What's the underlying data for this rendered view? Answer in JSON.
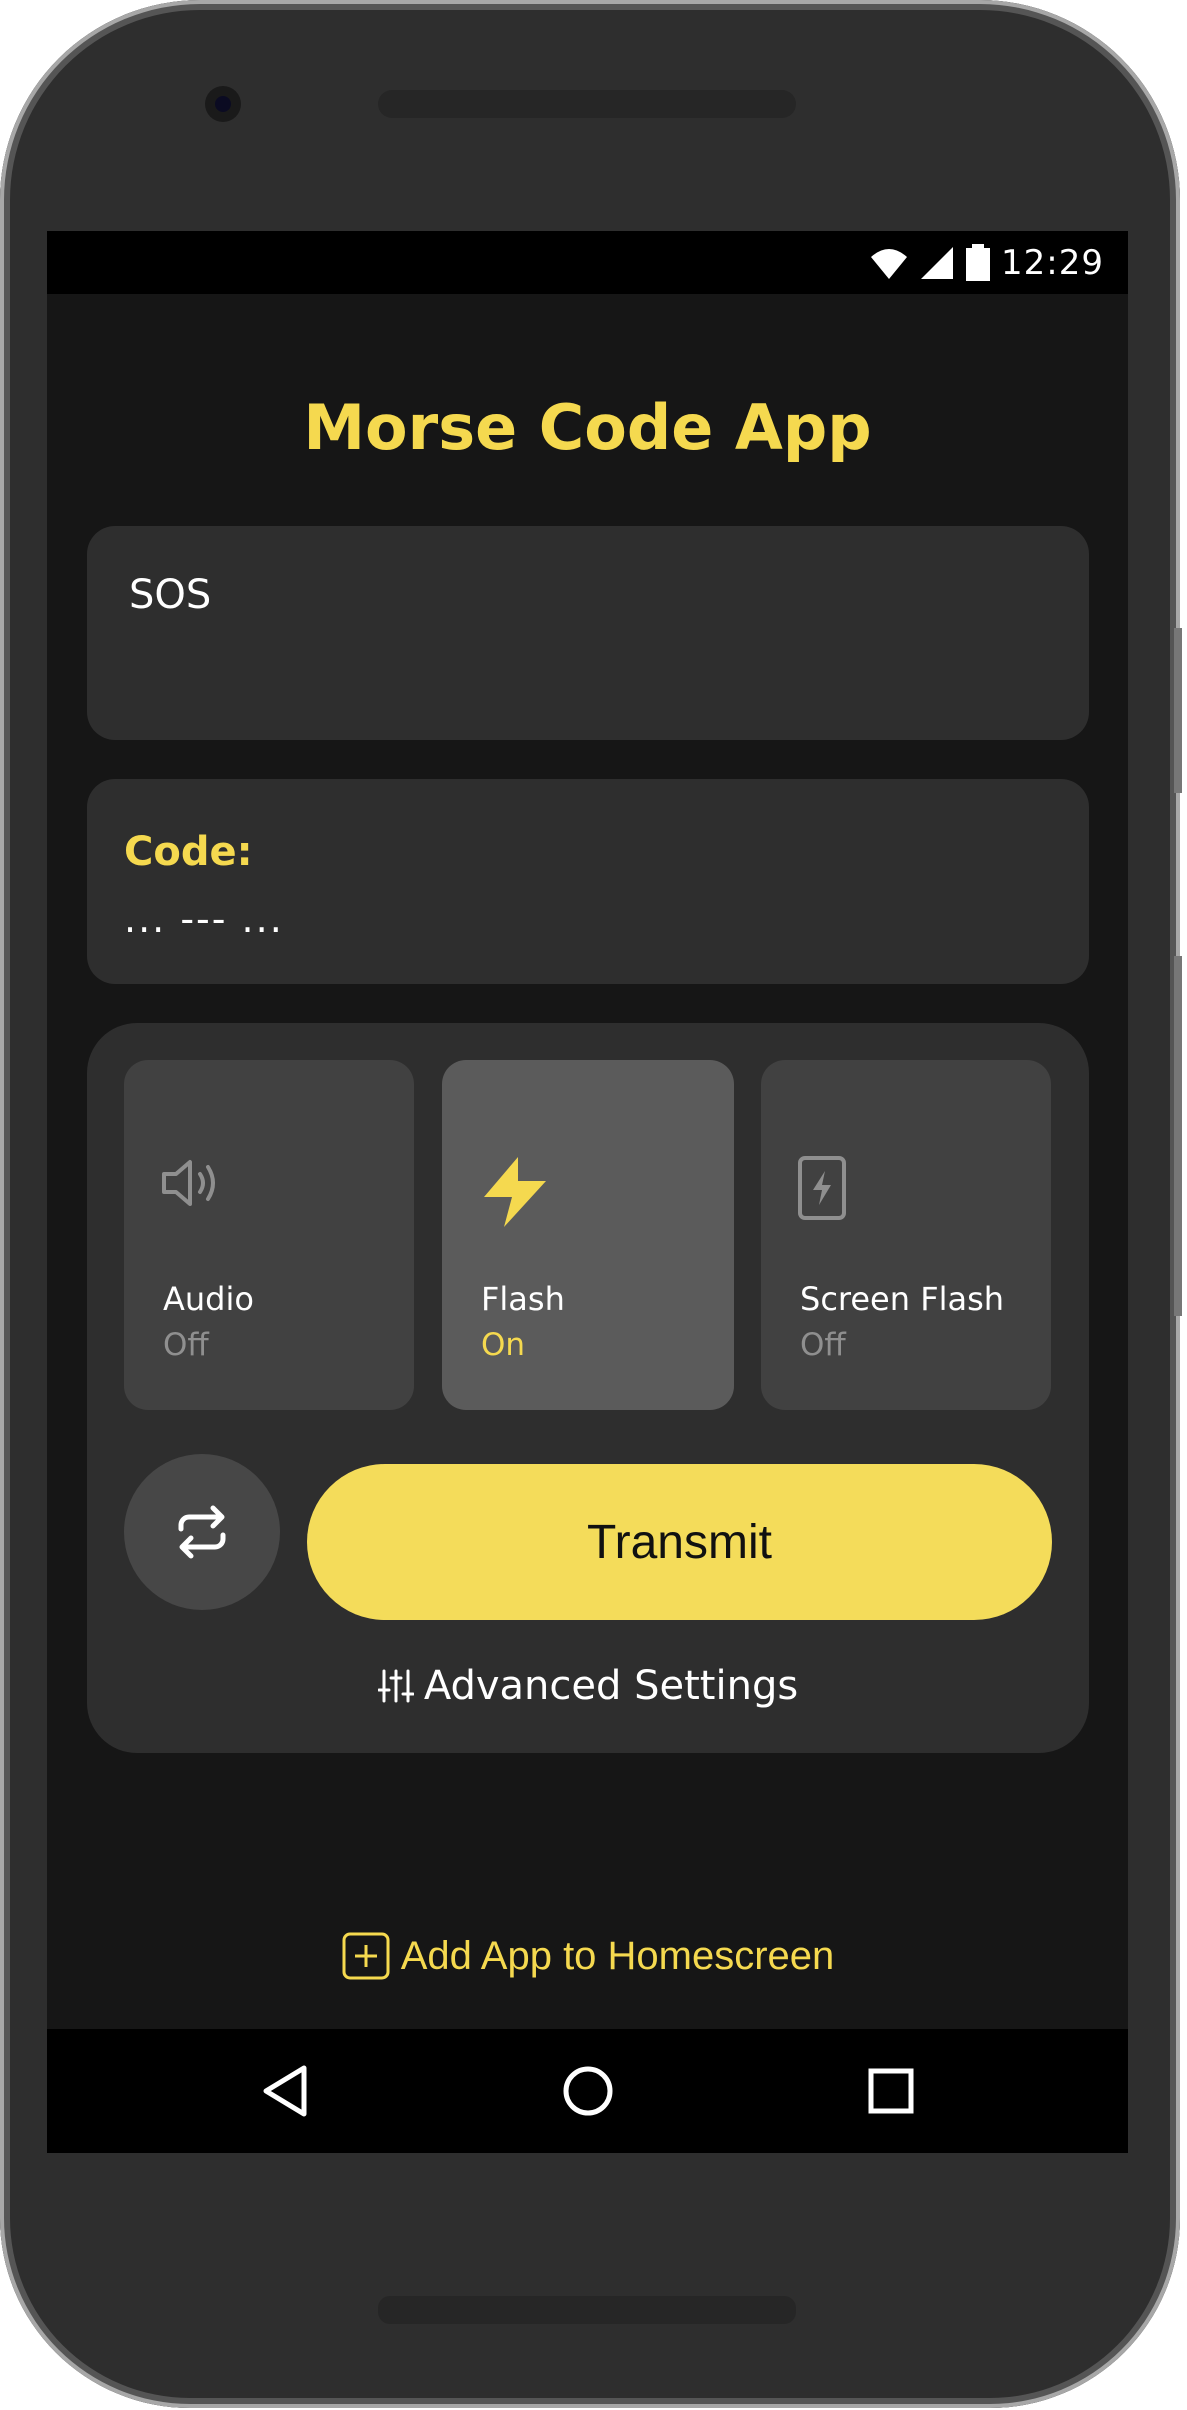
{
  "status_bar": {
    "time": "12:29"
  },
  "app": {
    "title": "Morse Code App"
  },
  "input": {
    "value": "SOS"
  },
  "output": {
    "label": "Code:",
    "value": "... --- ..."
  },
  "modes": [
    {
      "name": "Audio",
      "state": "Off",
      "icon": "speaker-icon",
      "active": false
    },
    {
      "name": "Flash",
      "state": "On",
      "icon": "lightning-icon",
      "active": true
    },
    {
      "name": "Screen Flash",
      "state": "Off",
      "icon": "phone-flash-icon",
      "active": false
    }
  ],
  "actions": {
    "repeat_icon": "repeat-icon",
    "transmit_label": "Transmit",
    "advanced_label": "Advanced Settings",
    "add_home_label": "Add App to Homescreen"
  },
  "colors": {
    "accent": "#f5d94f",
    "background": "#161616",
    "card": "#2e2e2e",
    "mode_tile": "#414141",
    "mode_tile_active": "#5b5b5b"
  }
}
